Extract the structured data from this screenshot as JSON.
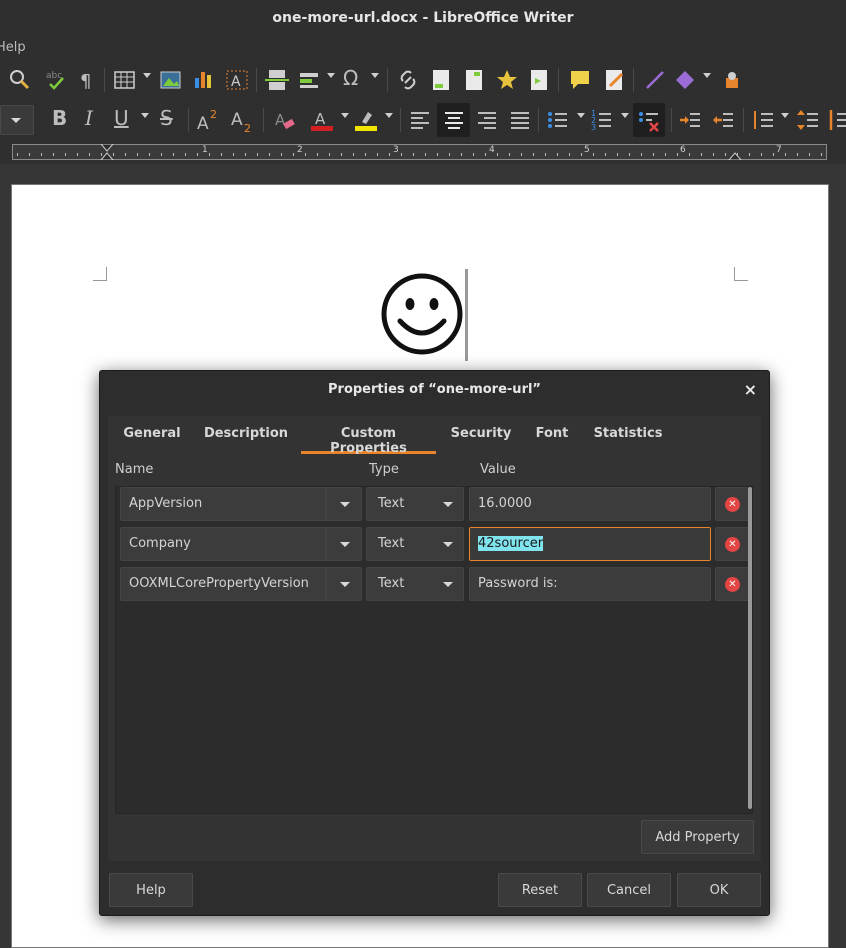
{
  "window": {
    "title": "one-more-url.docx - LibreOffice Writer",
    "menu_help": "Help"
  },
  "ruler": {
    "numbers": [
      "1",
      "2",
      "3",
      "4",
      "5",
      "6",
      "7"
    ]
  },
  "toolbar": {
    "icons": [
      "spellcheck-icon",
      "auto-spellcheck-icon",
      "formatting-marks-icon",
      "insert-table-icon",
      "insert-image-icon",
      "insert-chart-icon",
      "insert-textbox-icon",
      "insert-page-break-icon",
      "insert-field-icon",
      "insert-special-character-icon",
      "insert-hyperlink-icon",
      "insert-footnote-icon",
      "insert-endnote-icon",
      "insert-bookmark-icon",
      "insert-cross-reference-icon",
      "insert-comment-icon",
      "track-changes-icon",
      "insert-line-icon",
      "basic-shapes-icon",
      "show-draw-functions-icon"
    ],
    "format_icons": [
      "bold-icon",
      "italic-icon",
      "underline-icon",
      "strikethrough-icon",
      "superscript-icon",
      "subscript-icon",
      "clear-formatting-icon",
      "font-color-icon",
      "highlight-color-icon",
      "align-left-icon",
      "align-center-icon",
      "align-right-icon",
      "justify-icon",
      "unordered-list-icon",
      "ordered-list-icon",
      "no-list-icon",
      "increase-indent-icon",
      "decrease-indent-icon",
      "line-spacing-icon",
      "paragraph-spacing-icon"
    ],
    "accent": "#e8842c"
  },
  "document": {
    "smiley": "☺"
  },
  "dialog": {
    "title": "Properties of “one-more-url”",
    "close": "×",
    "tabs": [
      {
        "label": "General"
      },
      {
        "label": "Description"
      },
      {
        "label": "Custom Properties"
      },
      {
        "label": "Security"
      },
      {
        "label": "Font"
      },
      {
        "label": "Statistics"
      }
    ],
    "active_tab": "Custom Properties",
    "columns": {
      "name": "Name",
      "type": "Type",
      "value": "Value"
    },
    "properties": [
      {
        "name": "AppVersion",
        "type": "Text",
        "value": "16.0000"
      },
      {
        "name": "Company",
        "type": "Text",
        "value": "42sourcer"
      },
      {
        "name": "OOXMLCorePropertyVersion",
        "type": "Text",
        "value": "Password is:"
      }
    ],
    "add_property": "Add Property",
    "buttons": {
      "help": "Help",
      "reset": "Reset",
      "cancel": "Cancel",
      "ok": "OK"
    }
  }
}
